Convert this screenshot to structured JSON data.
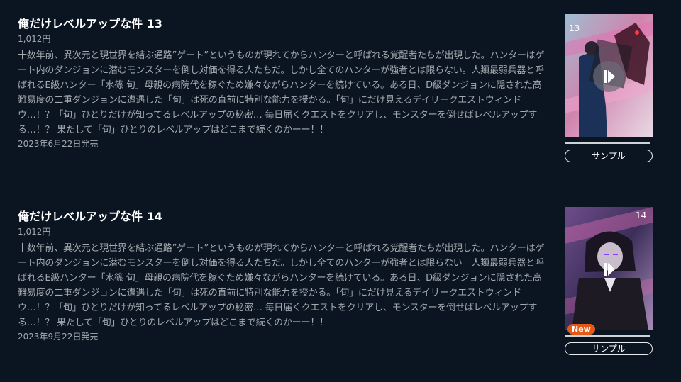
{
  "items": [
    {
      "title": "俺だけレベルアップな件 13",
      "price": "1,012円",
      "description": "十数年前、異次元と現世界を結ぶ通路”ゲート”というものが現れてからハンターと呼ばれる覚醒者たちが出現した。ハンターはゲート内のダンジョンに潜むモンスターを倒し対価を得る人たちだ。しかし全てのハンターが強者とは限らない。人類最弱兵器と呼ばれるE級ハンター「水篠 旬」母親の病院代を稼ぐため嫌々ながらハンターを続けている。ある日、D級ダンジョンに隠された高難易度の二重ダンジョンに遭遇した「旬」は死の直前に特別な能力を授かる。「旬」にだけ見えるデイリークエストウィンドウ…！？「旬」ひとりだけが知ってるレベルアップの秘密… 毎日届くクエストをクリアし、モンスターを倒せばレベルアップする…！？ 果たして「旬」ひとりのレベルアップはどこまで続くのかーー！！",
      "release_date": "2023年6月22日発売",
      "sample_label": "サンプル",
      "cover_volume": "13",
      "cover_icon": "play-icon"
    },
    {
      "title": "俺だけレベルアップな件 14",
      "price": "1,012円",
      "description": "十数年前、異次元と現世界を結ぶ通路”ゲート”というものが現れてからハンターと呼ばれる覚醒者たちが出現した。ハンターはゲート内のダンジョンに潜むモンスターを倒し対価を得る人たちだ。しかし全てのハンターが強者とは限らない。人類最弱兵器と呼ばれるE級ハンター「水篠 旬」母親の病院代を稼ぐため嫌々ながらハンターを続けている。ある日、D級ダンジョンに隠された高難易度の二重ダンジョンに遭遇した「旬」は死の直前に特別な能力を授かる。「旬」にだけ見えるデイリークエストウィンドウ…！？「旬」ひとりだけが知ってるレベルアップの秘密… 毎日届くクエストをクリアし、モンスターを倒せばレベルアップする…！？ 果たして「旬」ひとりのレベルアップはどこまで続くのかーー！！",
      "release_date": "2023年9月22日発売",
      "sample_label": "サンプル",
      "cover_volume": "14",
      "cover_icon": "play-icon",
      "badge": "New"
    }
  ],
  "colors": {
    "background": "#0b1521",
    "title": "#ffffff",
    "body_text": "#a4a9b0",
    "new_badge": "#e35a16"
  }
}
